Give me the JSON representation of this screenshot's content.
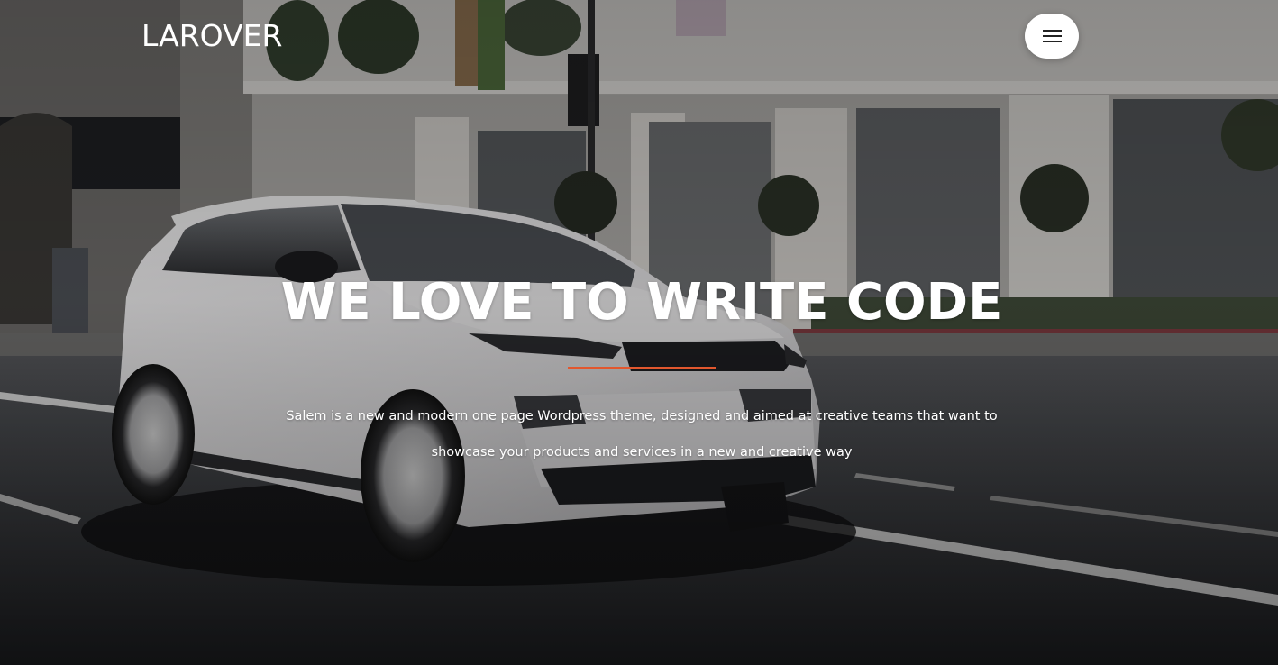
{
  "header": {
    "logo_text": "LAROVER",
    "menu_icon": "hamburger-icon"
  },
  "hero": {
    "title": "WE LOVE TO WRITE CODE",
    "underline_color": "#e2572e",
    "description": "Salem is a new and modern one page Wordpress theme, designed and aimed at creative teams that want to showcase your products and services in a new and creative way"
  },
  "colors": {
    "accent": "#e2572e",
    "text": "#ffffff",
    "menu_button_bg": "#ffffff"
  }
}
